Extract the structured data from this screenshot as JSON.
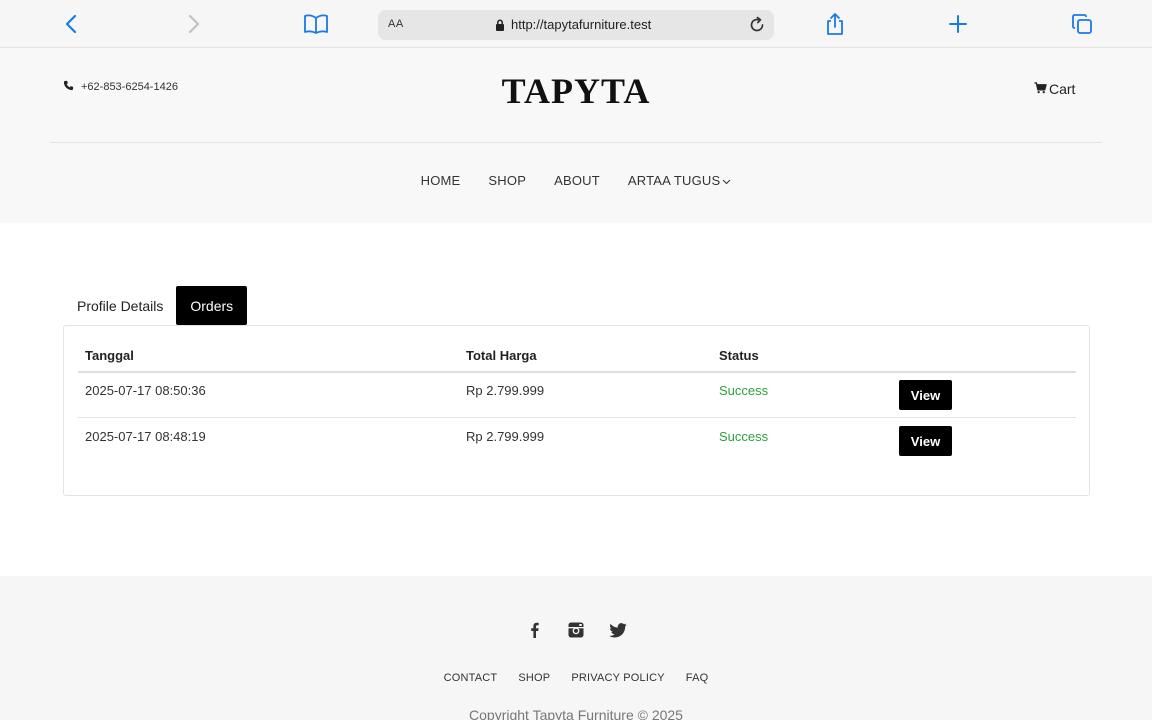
{
  "browser": {
    "text_size_label": "AA",
    "url": "http://tapytafurniture.test",
    "icons": [
      "back-arrow-icon",
      "forward-arrow-icon",
      "bookmarks-book-icon",
      "lock-icon",
      "reload-icon",
      "share-icon",
      "new-tab-plus-icon",
      "tabs-overview-icon"
    ]
  },
  "header": {
    "phone": "+62-853-6254-1426",
    "brand": "TAPYTA",
    "cart_label": "Cart"
  },
  "nav": {
    "items": [
      "HOME",
      "SHOP",
      "ABOUT",
      "ARTAA TUGUS"
    ]
  },
  "tabs": [
    {
      "label": "Profile Details",
      "active": false
    },
    {
      "label": "Orders",
      "active": true
    }
  ],
  "orders": {
    "columns": [
      "Tanggal",
      "Total Harga",
      "Status"
    ],
    "rows": [
      {
        "tanggal": "2025-07-17 08:50:36",
        "total": "Rp 2.799.999",
        "status": "Success",
        "action": "View"
      },
      {
        "tanggal": "2025-07-17 08:48:19",
        "total": "Rp 2.799.999",
        "status": "Success",
        "action": "View"
      }
    ]
  },
  "footer": {
    "social_icons": [
      "facebook-icon",
      "instagram-icon",
      "twitter-icon"
    ],
    "links": [
      "CONTACT",
      "SHOP",
      "PRIVACY POLICY",
      "FAQ"
    ],
    "copyright": "Copyright Tapyta Furniture © 2025"
  },
  "colors": {
    "browser_accent": "#1a7ae6",
    "status_success": "#2e9e3c",
    "button_bg": "#000000",
    "header_bg": "#f8f8f8"
  }
}
